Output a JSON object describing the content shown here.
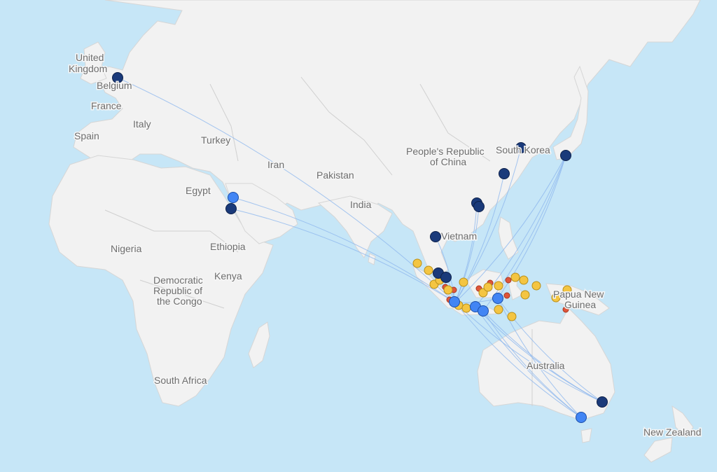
{
  "map": {
    "labels": [
      {
        "id": "uk",
        "text": "United Kingdom"
      },
      {
        "id": "belgium",
        "text": "Belgium"
      },
      {
        "id": "france",
        "text": "France"
      },
      {
        "id": "spain",
        "text": "Spain"
      },
      {
        "id": "italy",
        "text": "Italy"
      },
      {
        "id": "turkey",
        "text": "Turkey"
      },
      {
        "id": "iran",
        "text": "Iran"
      },
      {
        "id": "pakistan",
        "text": "Pakistan"
      },
      {
        "id": "india",
        "text": "India"
      },
      {
        "id": "egypt",
        "text": "Egypt"
      },
      {
        "id": "nigeria",
        "text": "Nigeria"
      },
      {
        "id": "ethiopia",
        "text": "Ethiopia"
      },
      {
        "id": "kenya",
        "text": "Kenya"
      },
      {
        "id": "drc",
        "text": "Democratic Republic of the Congo"
      },
      {
        "id": "south-africa",
        "text": "South Africa"
      },
      {
        "id": "china",
        "text": "People's Republic of China"
      },
      {
        "id": "south-korea",
        "text": "South Korea"
      },
      {
        "id": "vietnam",
        "text": "Vietnam"
      },
      {
        "id": "png",
        "text": "Papua New Guinea"
      },
      {
        "id": "australia",
        "text": "Australia"
      },
      {
        "id": "new-zealand",
        "text": "New Zealand"
      }
    ],
    "colors": {
      "ocean": "#c6e6f7",
      "land": "#f2f2f2",
      "route": "#8fb8ee",
      "marker_dark": "#1a3a7a",
      "marker_blue": "#4285f4",
      "marker_yellow": "#f4c542",
      "marker_red": "#e0553a"
    }
  }
}
